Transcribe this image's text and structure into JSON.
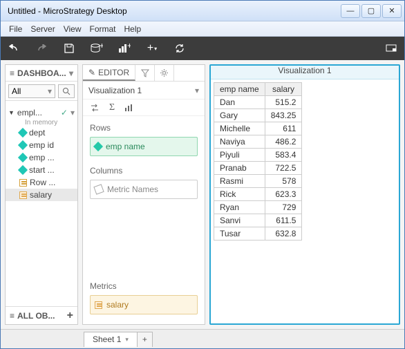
{
  "window": {
    "title": "Untitled - MicroStrategy Desktop"
  },
  "menu": {
    "file": "File",
    "server": "Server",
    "view": "View",
    "format": "Format",
    "help": "Help"
  },
  "sidebar": {
    "header": "DASHBOA...",
    "all_label": "All",
    "group_label": "empl...",
    "subtitle": "In memory",
    "items": [
      {
        "label": "dept",
        "type": "attr"
      },
      {
        "label": "emp id",
        "type": "attr"
      },
      {
        "label": "emp ...",
        "type": "attr"
      },
      {
        "label": "start ...",
        "type": "attr"
      },
      {
        "label": "Row ...",
        "type": "row"
      },
      {
        "label": "salary",
        "type": "metric",
        "selected": true
      }
    ],
    "footer": "ALL OB..."
  },
  "editor": {
    "tab_label": "EDITOR",
    "viz_title": "Visualization 1",
    "rows_label": "Rows",
    "rows_chip": "emp name",
    "cols_label": "Columns",
    "cols_chip": "Metric Names",
    "metrics_label": "Metrics",
    "metrics_chip": "salary"
  },
  "viz": {
    "title": "Visualization 1",
    "headers": {
      "name": "emp name",
      "salary": "salary"
    },
    "rows": [
      {
        "n": "Dan",
        "v": "515.2"
      },
      {
        "n": "Gary",
        "v": "843.25"
      },
      {
        "n": "Michelle",
        "v": "611"
      },
      {
        "n": "Naviya",
        "v": "486.2"
      },
      {
        "n": "Piyuli",
        "v": "583.4"
      },
      {
        "n": "Pranab",
        "v": "722.5"
      },
      {
        "n": "Rasmi",
        "v": "578"
      },
      {
        "n": "Rick",
        "v": "623.3"
      },
      {
        "n": "Ryan",
        "v": "729"
      },
      {
        "n": "Sanvi",
        "v": "611.5"
      },
      {
        "n": "Tusar",
        "v": "632.8"
      }
    ]
  },
  "sheet": {
    "label": "Sheet 1"
  }
}
